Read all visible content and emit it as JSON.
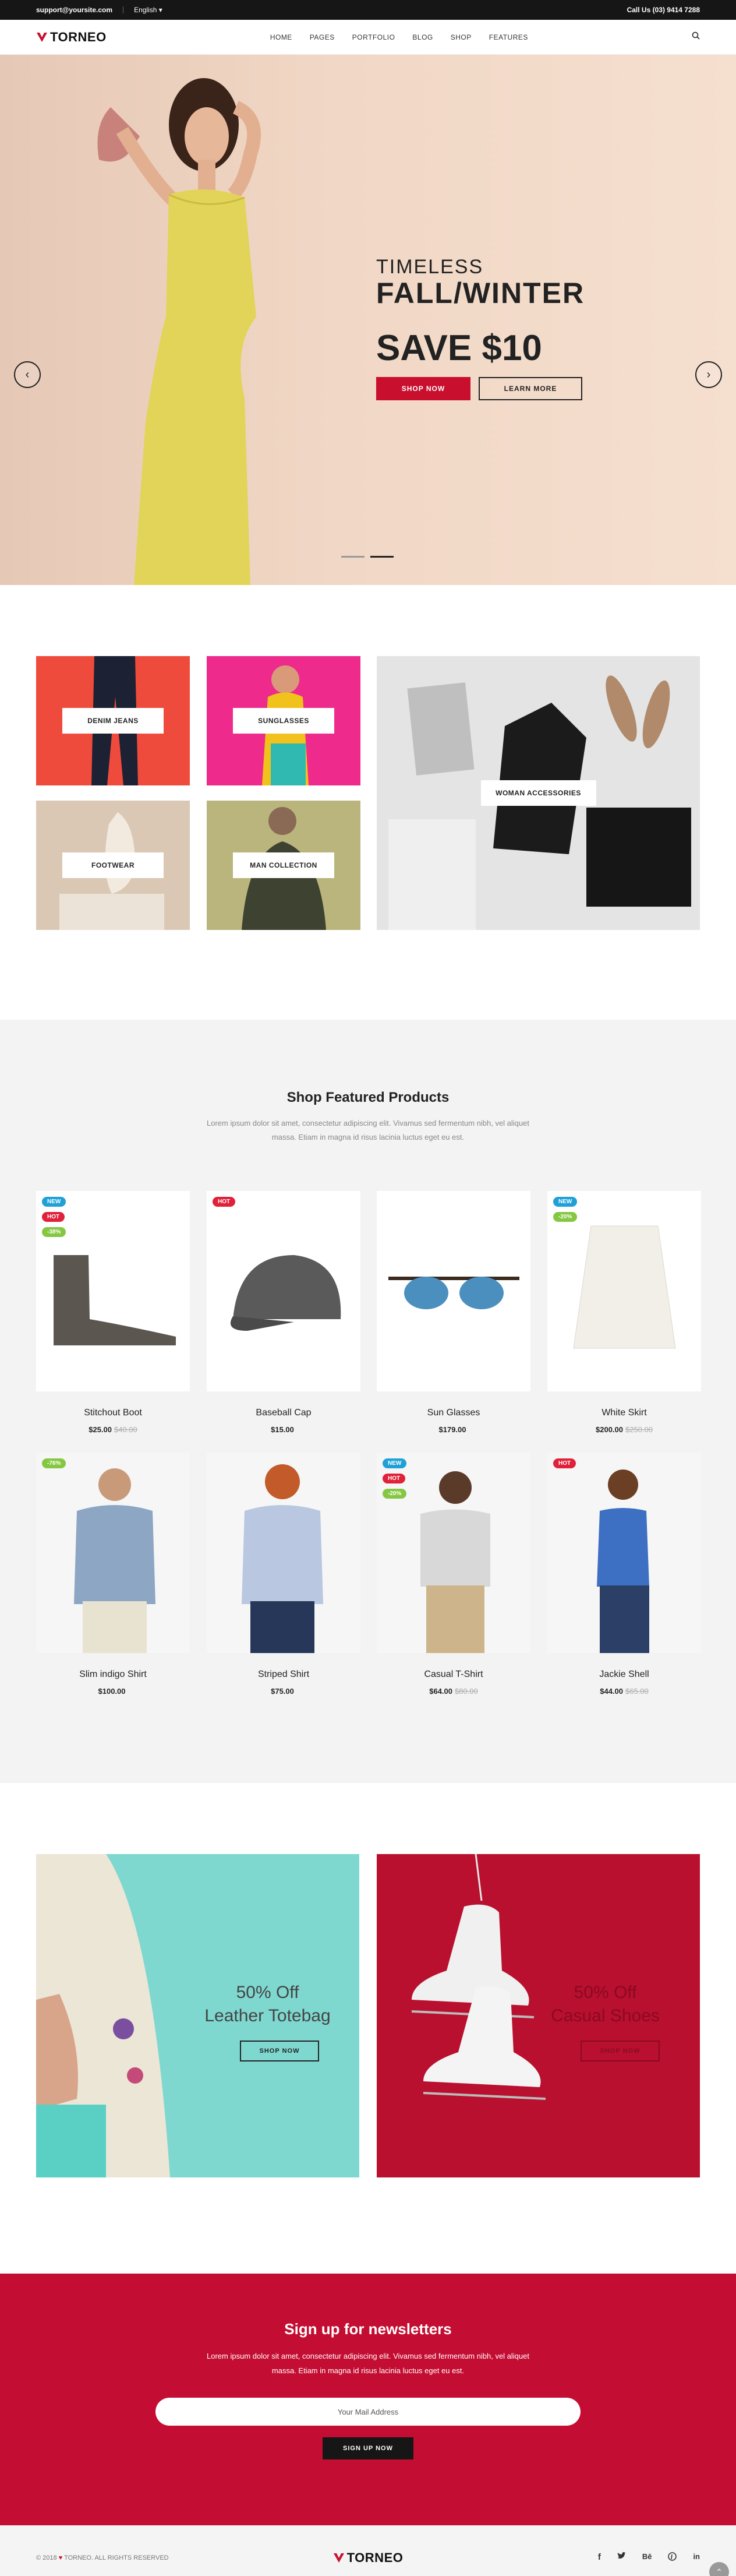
{
  "topbar": {
    "email": "support@yoursite.com",
    "language": "English",
    "phone": "Call Us (03) 9414 7288"
  },
  "header": {
    "brand": "TORNEO",
    "menu": [
      "HOME",
      "PAGES",
      "PORTFOLIO",
      "BLOG",
      "SHOP",
      "FEATURES"
    ]
  },
  "hero": {
    "subtitle": "TIMELESS",
    "title": "FALL/WINTER",
    "headline": "SAVE $10",
    "primary_button": "SHOP NOW",
    "secondary_button": "LEARN MORE",
    "slide_count": 2,
    "active_slide": 2
  },
  "categories": [
    "DENIM JEANS",
    "SUNGLASSES",
    "WOMAN ACCESSORIES",
    "FOOTWEAR",
    "MAN COLLECTION"
  ],
  "featured": {
    "title": "Shop Featured Products",
    "description_line1": "Lorem ipsum dolor sit amet, consectetur adipiscing elit. Vivamus sed fermentum nibh, vel aliquet",
    "description_line2": "massa. Etiam in magna id risus lacinia luctus eget eu est.",
    "products": [
      {
        "name": "Stitchout Boot",
        "price": "$25.00",
        "old_price": "$40.00",
        "badges": [
          "NEW",
          "HOT",
          "-38%"
        ]
      },
      {
        "name": "Baseball Cap",
        "price": "$15.00",
        "old_price": "",
        "badges": [
          "HOT"
        ]
      },
      {
        "name": "Sun Glasses",
        "price": "$179.00",
        "old_price": "",
        "badges": []
      },
      {
        "name": "White Skirt",
        "price": "$200.00",
        "old_price": "$250.00",
        "badges": [
          "NEW",
          "-20%"
        ]
      },
      {
        "name": "Slim indigo Shirt",
        "price": "$100.00",
        "old_price": "",
        "badges": [
          "-76%"
        ]
      },
      {
        "name": "Striped Shirt",
        "price": "$75.00",
        "old_price": "",
        "badges": []
      },
      {
        "name": "Casual T-Shirt",
        "price": "$64.00",
        "old_price": "$80.00",
        "badges": [
          "NEW",
          "HOT",
          "-20%"
        ]
      },
      {
        "name": "Jackie Shell",
        "price": "$44.00",
        "old_price": "$65.00",
        "badges": [
          "HOT"
        ]
      }
    ]
  },
  "promos": [
    {
      "line1": "50% Off",
      "line2": "Leather Totebag",
      "button": "SHOP NOW"
    },
    {
      "line1": "50% Off",
      "line2": "Casual Shoes",
      "button": "SHOP NOW"
    }
  ],
  "newsletter": {
    "title": "Sign up for newsletters",
    "line1": "Lorem ipsum dolor sit amet, consectetur adipiscing elit. Vivamus sed fermentum nibh, vel aliquet",
    "line2": "massa. Etiam in magna id risus lacinia luctus eget eu est.",
    "placeholder": "Your Mail Address",
    "button": "SIGN UP NOW"
  },
  "footer": {
    "copyright_year": "© 2018",
    "copyright_text": "TORNEO. ALL RIGHTS RESERVED",
    "brand": "TORNEO",
    "social": [
      "facebook-icon",
      "twitter-icon",
      "behance-icon",
      "pinterest-icon",
      "linkedin-icon"
    ]
  },
  "colors": {
    "accent": "#c8102e",
    "dark": "#161616",
    "new_badge": "#1fa1d8",
    "hot_badge": "#e0213a",
    "sale_badge": "#85c742"
  }
}
